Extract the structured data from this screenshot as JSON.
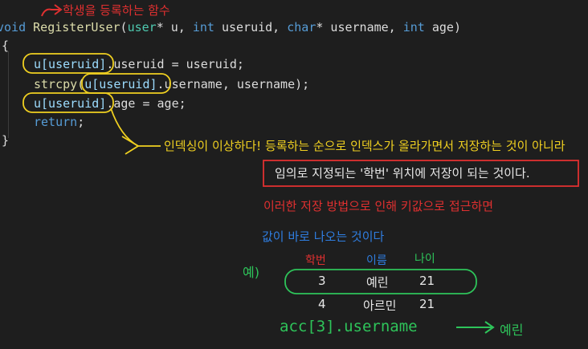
{
  "code": {
    "line1": {
      "keyword_void": "void",
      "fn_name": "RegisterUser",
      "paren_open": "(",
      "type_user": "user",
      "p1": "* u, ",
      "kw_int": "int",
      "p2": " useruid, ",
      "kw_char": "char",
      "p3": "* username, ",
      "kw_int2": "int",
      "p4": " age)"
    },
    "brace_open": "{",
    "line3": {
      "a": "u[useruid]",
      "b": ".useruid",
      "c": " = useruid;"
    },
    "line4": {
      "a": "strcpy(",
      "b": "u[useruid]",
      "c": ".username",
      "d": ", username);"
    },
    "line5": {
      "a": "u[useruid]",
      "b": ".age",
      "c": " = age;"
    },
    "line6": {
      "a": "return",
      "b": ";"
    },
    "brace_close": "}"
  },
  "annotations": {
    "top_note": "학생을 등록하는 함수",
    "yellow_note": "인덱싱이 이상하다! 등록하는 순으로 인덱스가 올라가면서 저장하는 것이 아니라",
    "red_box_note": "임의로 지정되는 '학번' 위치에 저장이 되는 것이다.",
    "red_note": "이러한 저장 방법으로 인해 키값으로 접근하면",
    "blue_note": "값이 바로 나오는 것이다",
    "example_label": "예)",
    "table": {
      "headers": [
        "학번",
        "이름",
        "나이"
      ],
      "rows": [
        [
          "3",
          "예린",
          "21"
        ],
        [
          "4",
          "아르민",
          "21"
        ]
      ]
    },
    "access_expr": "acc[3].username",
    "arrow_result": "예린"
  },
  "colors": {
    "red": "#e03030",
    "yellow": "#f0d020",
    "blue": "#2f7de0",
    "green": "#2ec45a",
    "white": "#e8e8e8"
  }
}
